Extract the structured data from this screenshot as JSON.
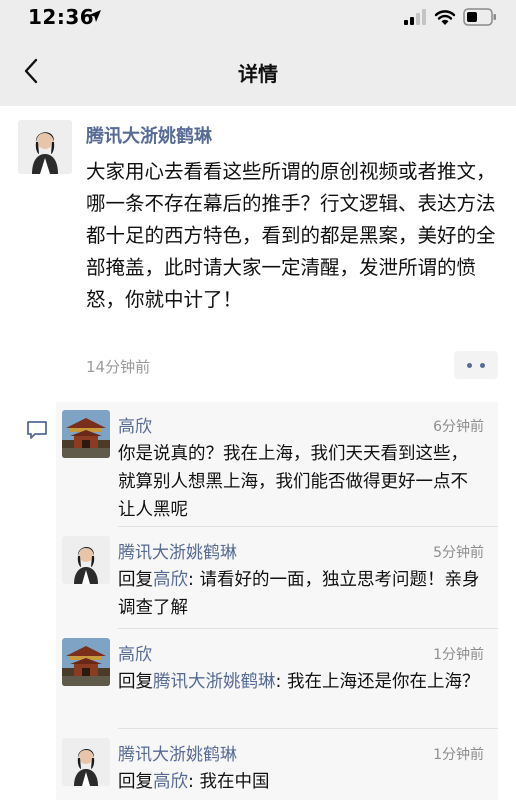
{
  "status_bar": {
    "time": "12:36"
  },
  "nav": {
    "title": "详情",
    "back_icon": "chevron-left-icon"
  },
  "post": {
    "author": "腾讯大浙姚鹤琳",
    "text": "大家用心去看看这些所谓的原创视频或者推文，哪一条不存在幕后的推手？行文逻辑、表达方法都十足的西方特色，看到的都是黑案，美好的全部掩盖，此时请大家一定清醒，发泄所谓的愤怒，你就中计了！",
    "time": "14分钟前"
  },
  "comments": [
    {
      "name": "高欣",
      "time": "6分钟前",
      "text": "你是说真的？我在上海，我们天天看到这些，就算别人想黑上海，我们能否做得更好一点不让人黑呢"
    },
    {
      "name": "腾讯大浙姚鹤琳",
      "time": "5分钟前",
      "reply_prefix": "回复",
      "reply_to": "高欣",
      "text": ": 请看好的一面，独立思考问题！亲身调查了解"
    },
    {
      "name": "高欣",
      "time": "1分钟前",
      "reply_prefix": "回复",
      "reply_to": "腾讯大浙姚鹤琳",
      "text": ": 我在上海还是你在上海？"
    },
    {
      "name": "腾讯大浙姚鹤琳",
      "time": "1分钟前",
      "reply_prefix": "回复",
      "reply_to": "高欣",
      "text": ": 我在中国"
    }
  ],
  "colors": {
    "link": "#576b95",
    "bar_bg": "#ededed",
    "comment_bg": "#f7f7f7"
  }
}
